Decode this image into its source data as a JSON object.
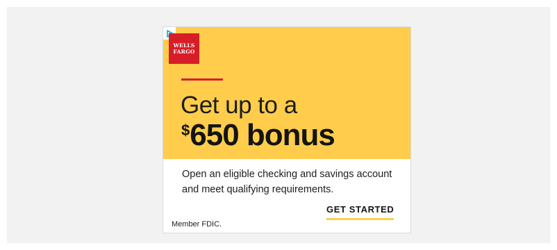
{
  "ad": {
    "logo": {
      "line1": "WELLS",
      "line2": "FARGO"
    },
    "headline_line1": "Get up to a",
    "headline_currency": "$",
    "headline_amount": "650 bonus",
    "description": "Open an eligible checking and savings account and meet qualifying requirements.",
    "cta_label": "GET STARTED",
    "disclaimer": "Member FDIC."
  },
  "icons": {
    "adchoices": "adchoices-icon"
  },
  "colors": {
    "page_background": "#f2f2f2",
    "ad_top_background": "#ffcd4b",
    "brand_red": "#d71e28",
    "text": "#141414",
    "cta_underline": "#ffcd4b"
  }
}
